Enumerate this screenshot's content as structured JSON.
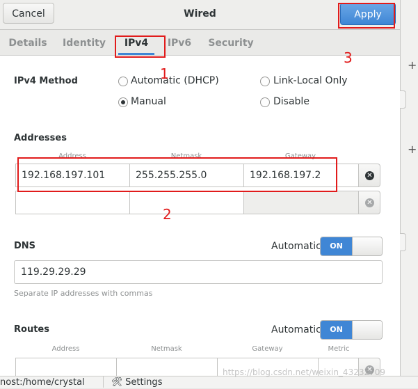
{
  "header": {
    "title": "Wired",
    "cancel_label": "Cancel",
    "apply_label": "Apply"
  },
  "tabs": [
    {
      "label": "Details",
      "active": false
    },
    {
      "label": "Identity",
      "active": false
    },
    {
      "label": "IPv4",
      "active": true
    },
    {
      "label": "IPv6",
      "active": false
    },
    {
      "label": "Security",
      "active": false
    }
  ],
  "ipv4_method": {
    "title": "IPv4 Method",
    "options": [
      {
        "label": "Automatic (DHCP)",
        "checked": false
      },
      {
        "label": "Link-Local Only",
        "checked": false
      },
      {
        "label": "Manual",
        "checked": true
      },
      {
        "label": "Disable",
        "checked": false
      }
    ]
  },
  "addresses": {
    "title": "Addresses",
    "columns": [
      "Address",
      "Netmask",
      "Gateway"
    ],
    "rows": [
      {
        "address": "192.168.197.101",
        "netmask": "255.255.255.0",
        "gateway": "192.168.197.2"
      },
      {
        "address": "",
        "netmask": "",
        "gateway": ""
      }
    ]
  },
  "dns": {
    "title": "DNS",
    "automatic_label": "Automatic",
    "switch_state": "ON",
    "value": "119.29.29.29",
    "hint": "Separate IP addresses with commas"
  },
  "routes": {
    "title": "Routes",
    "automatic_label": "Automatic",
    "switch_state": "ON",
    "columns": [
      "Address",
      "Netmask",
      "Gateway",
      "Metric"
    ]
  },
  "annotations": [
    "1",
    "2",
    "3"
  ],
  "taskbar": {
    "terminal_label": "nost:/home/crystal",
    "settings_label": "Settings"
  },
  "background_window": {
    "plus_1": "+",
    "plus_2": "+"
  },
  "watermark": "https://blog.csdn.net/weixin_43232709",
  "colors": {
    "accent": "#3f86d5",
    "annotation": "#e11b1b"
  },
  "icons": {
    "delete": "circle-x-icon",
    "radio": "radio-icon",
    "settings": "settings-icon"
  }
}
